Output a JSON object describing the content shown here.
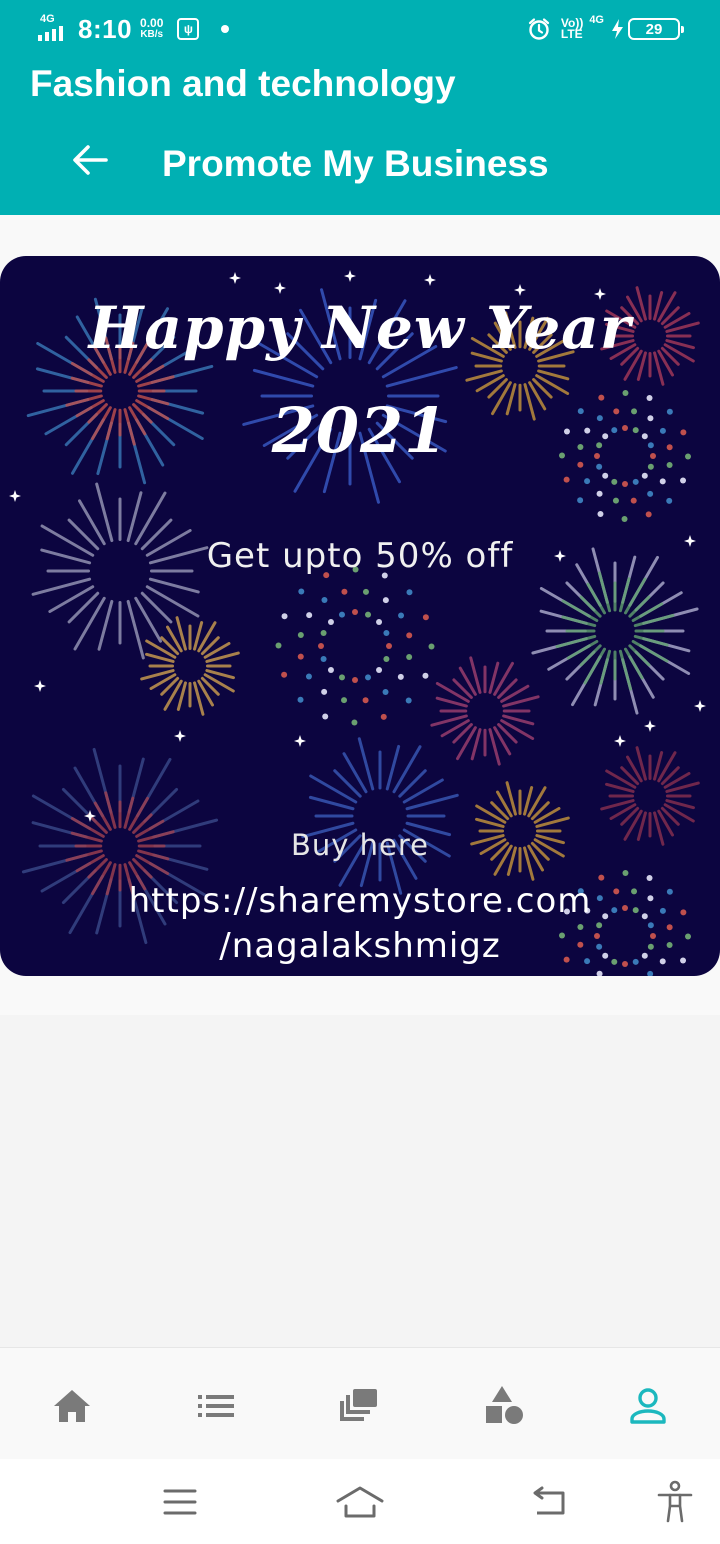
{
  "status_bar": {
    "network_tag": "4G",
    "time": "8:10",
    "speed_value": "0.00",
    "speed_unit": "KB/s",
    "volte_top": "Vo))",
    "volte_bottom": "LTE",
    "net_type": "4G",
    "battery_level": "29"
  },
  "header": {
    "app_title": "Fashion and technology",
    "page_title": "Promote My Business"
  },
  "promo": {
    "heading_line1": "Happy New Year",
    "heading_line2": "2021",
    "offer": "Get upto 50% off",
    "cta": "Buy here",
    "url_line1": "https://sharemystore.com",
    "url_line2": "/nagalakshmigz"
  },
  "bottom_nav": {
    "items": [
      "home-icon",
      "list-icon",
      "gallery-icon",
      "shapes-icon",
      "profile-icon"
    ],
    "active_index": 4
  },
  "system_nav": [
    "menu-icon",
    "home-icon",
    "back-icon",
    "accessibility-icon"
  ],
  "colors": {
    "header": "#00b0b3",
    "accent": "#1cb8be",
    "card_bg": "#0c0540",
    "icon_inactive": "#7a7a7a"
  }
}
